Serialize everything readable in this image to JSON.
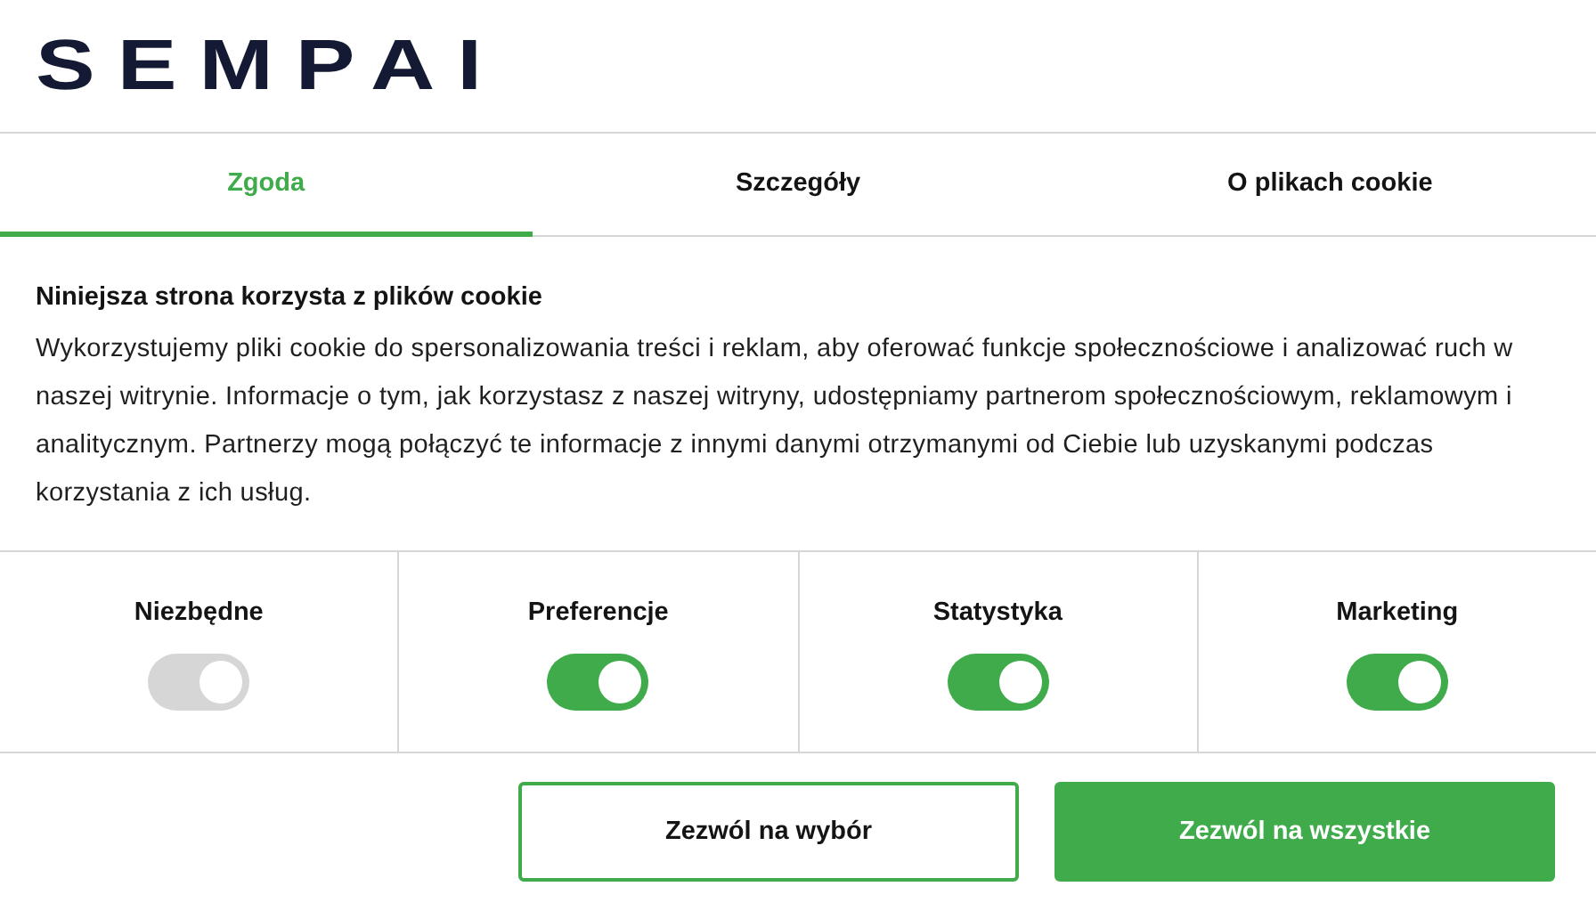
{
  "logo": {
    "text": "SEMPAI"
  },
  "tabs": [
    {
      "label": "Zgoda",
      "selected": true
    },
    {
      "label": "Szczegóły",
      "selected": false
    },
    {
      "label": "O plikach cookie",
      "selected": false
    }
  ],
  "content": {
    "heading": "Niniejsza strona korzysta z plików cookie",
    "text": "Wykorzystujemy pliki cookie do spersonalizowania treści i reklam, aby oferować funkcje społecznościowe i analizować ruch w naszej witrynie. Informacje o tym, jak korzystasz z naszej witryny, udostępniamy partnerom społecznościowym, reklamowym i analitycznym. Partnerzy mogą połączyć te informacje z innymi danymi otrzymanymi od Ciebie lub uzyskanymi podczas korzystania z ich usług."
  },
  "categories": [
    {
      "label": "Niezbędne",
      "checked": true,
      "disabled": true
    },
    {
      "label": "Preferencje",
      "checked": true,
      "disabled": false
    },
    {
      "label": "Statystyka",
      "checked": true,
      "disabled": false
    },
    {
      "label": "Marketing",
      "checked": true,
      "disabled": false
    }
  ],
  "buttons": [
    {
      "label": "Zezwól na wybór",
      "kind": "outline"
    },
    {
      "label": "Zezwól na wszystkie",
      "kind": "primary"
    }
  ]
}
